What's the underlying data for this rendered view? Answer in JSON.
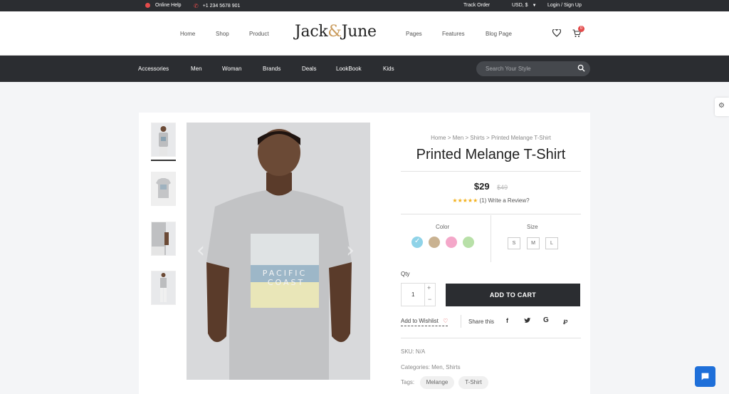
{
  "topbar": {
    "help": "Online Help",
    "phone": "+1 234 5678 901",
    "track": "Track Order",
    "currency": "USD, $",
    "login": "Login / Sign Up"
  },
  "nav": {
    "left": [
      "Home",
      "Shop",
      "Product"
    ],
    "right": [
      "Pages",
      "Features",
      "Blog Page"
    ],
    "logo_part1": "Jack",
    "logo_amp": "&",
    "logo_part2": "June",
    "cart_count": "0"
  },
  "categories": [
    "Accessories",
    "Men",
    "Woman",
    "Brands",
    "Deals",
    "LookBook",
    "Kids"
  ],
  "search": {
    "placeholder": "Search Your Style"
  },
  "product": {
    "breadcrumb": [
      "Home",
      "Men",
      "Shirts",
      "Printed Melange T-Shirt"
    ],
    "title": "Printed Melange T-Shirt",
    "price": "$29",
    "old_price": "$49",
    "rating": 5,
    "review_count": "(1)",
    "review_link": "Write a Review?",
    "color_label": "Color",
    "size_label": "Size",
    "colors": [
      "#8fd3e8",
      "#c9b291",
      "#f4a7c9",
      "#b8e0a8"
    ],
    "sizes": [
      "S",
      "M",
      "L"
    ],
    "qty_label": "Qty",
    "qty_value": "1",
    "add_to_cart": "ADD TO CART",
    "wishlist": "Add to Wishlist",
    "share": "Share this",
    "sku": "SKU: N/A",
    "categories": "Categories: Men, Shirts",
    "tags_label": "Tags:",
    "tags": [
      "Melange",
      "T-Shirt"
    ],
    "shirt_text": [
      "PACIFIC",
      "COAST"
    ]
  },
  "colors": {
    "dark": "#2b2d31",
    "accent": "#e34b4b",
    "gold": "#c99a5b"
  }
}
